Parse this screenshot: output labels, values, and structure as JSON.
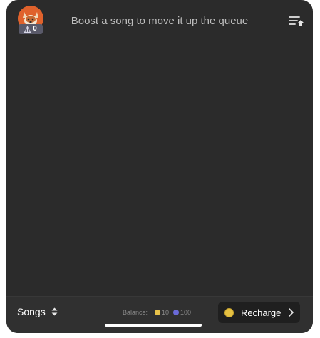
{
  "header": {
    "title": "Boost a song to move it up the queue",
    "badge_count": "0",
    "avatar_icon": "fox-avatar",
    "badge_icon": "boost-triangle-icon",
    "queue_icon": "queue-move-up-icon"
  },
  "bottom_bar": {
    "songs_label": "Songs",
    "balance_label": "Balance:",
    "gold_balance": "10",
    "blue_balance": "100",
    "recharge_label": "Recharge"
  },
  "colors": {
    "background": "#2b2b2b",
    "avatar": "#e0622c",
    "gold_coin": "#e8c24a",
    "blue_coin": "#6a6ad8"
  }
}
